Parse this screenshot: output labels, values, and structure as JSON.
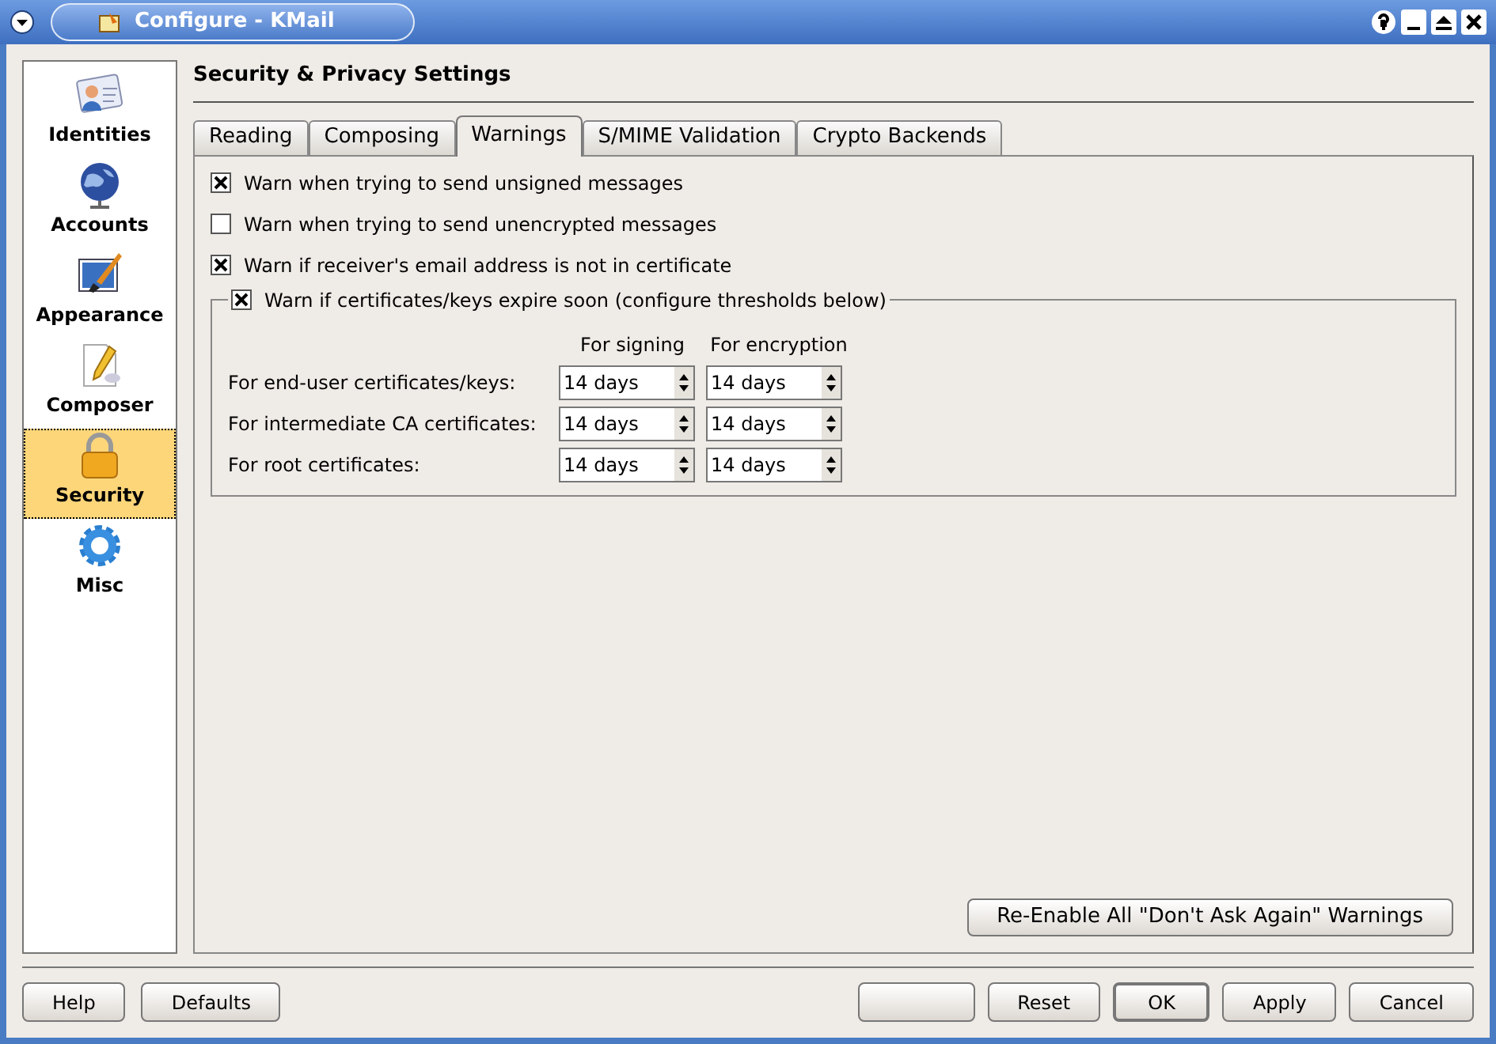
{
  "window": {
    "title": "Configure - KMail"
  },
  "sidebar": {
    "items": [
      {
        "label": "Identities",
        "selected": false
      },
      {
        "label": "Accounts",
        "selected": false
      },
      {
        "label": "Appearance",
        "selected": false
      },
      {
        "label": "Composer",
        "selected": false
      },
      {
        "label": "Security",
        "selected": true
      },
      {
        "label": "Misc",
        "selected": false
      }
    ]
  },
  "page_title": "Security & Privacy Settings",
  "tabs": [
    {
      "label": "Reading",
      "selected": false
    },
    {
      "label": "Composing",
      "selected": false
    },
    {
      "label": "Warnings",
      "selected": true
    },
    {
      "label": "S/MIME Validation",
      "selected": false
    },
    {
      "label": "Crypto Backends",
      "selected": false
    }
  ],
  "warnings": [
    {
      "label": "Warn when trying to send unsigned messages",
      "checked": true
    },
    {
      "label": "Warn when trying to send unencrypted messages",
      "checked": false
    },
    {
      "label": "Warn if receiver's email address is not in certificate",
      "checked": true
    }
  ],
  "expiry_group": {
    "label": "Warn if certificates/keys expire soon (configure thresholds below)",
    "checked": true,
    "columns": [
      "For signing",
      "For encryption"
    ],
    "rows": [
      {
        "label": "For end-user certificates/keys:",
        "values": [
          "14 days",
          "14 days"
        ]
      },
      {
        "label": "For intermediate CA certificates:",
        "values": [
          "14 days",
          "14 days"
        ]
      },
      {
        "label": "For root certificates:",
        "values": [
          "14 days",
          "14 days"
        ]
      }
    ]
  },
  "reenable_button": "Re-Enable All \"Don't Ask Again\" Warnings",
  "left_buttons": [
    {
      "label": "Help"
    },
    {
      "label": "Defaults"
    }
  ],
  "right_buttons": [
    {
      "kind": "blank"
    },
    {
      "kind": "text",
      "label": "Reset"
    },
    {
      "kind": "default",
      "label": "OK"
    },
    {
      "kind": "text",
      "label": "Apply"
    },
    {
      "kind": "text",
      "label": "Cancel"
    }
  ]
}
